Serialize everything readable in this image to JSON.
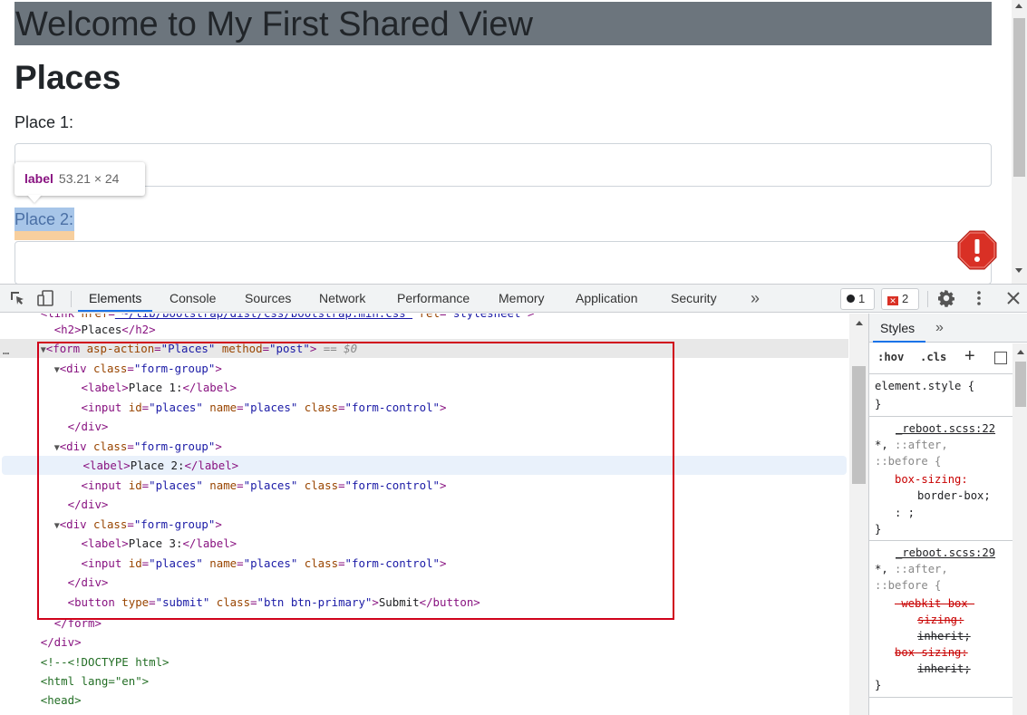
{
  "page": {
    "title": "Welcome to My First Shared View",
    "heading": "Places",
    "label_1": "Place 1:",
    "label_2": "Place 2:",
    "colors": {
      "title_bg": "#6c757d",
      "highlight": "#a7c5e8",
      "error_badge": "#d93025"
    }
  },
  "tooltip": {
    "tag": "label",
    "dims": "53.21 × 24"
  },
  "devtools": {
    "tabs": [
      "Elements",
      "Console",
      "Sources",
      "Network",
      "Performance",
      "Memory",
      "Application",
      "Security"
    ],
    "more_tabs": "»",
    "messages_count": "1",
    "errors_count": "2",
    "icons": [
      "inspect-icon",
      "device-toggle-icon",
      "gear-icon",
      "kebab-menu-icon",
      "close-icon"
    ]
  },
  "elements": {
    "dots": "…",
    "lines": [
      {
        "indent": 4,
        "html": "<link rel=\"stylesheet\" href=\"~/lib/bootstrap/dist/css/bootstrap.min.css\" />"
      },
      {
        "indent": 4,
        "open": "h2",
        "text": "Places"
      },
      {
        "indent": 3,
        "form": true
      },
      {
        "indent": 4,
        "div": "form-group"
      },
      {
        "indent": 6,
        "label": "Place 1:"
      },
      {
        "indent": 6,
        "input": true
      },
      {
        "indent": 5,
        "close": "div"
      },
      {
        "indent": 4,
        "div": "form-group"
      },
      {
        "indent": 6,
        "label": "Place 2:"
      },
      {
        "indent": 6,
        "input": true
      },
      {
        "indent": 5,
        "close": "div"
      },
      {
        "indent": 4,
        "div": "form-group"
      },
      {
        "indent": 6,
        "label": "Place 3:"
      },
      {
        "indent": 6,
        "input": true
      },
      {
        "indent": 5,
        "close": "div"
      },
      {
        "indent": 5,
        "button": "Submit"
      },
      {
        "indent": 4,
        "close": "form"
      },
      {
        "indent": 3,
        "close": "div"
      },
      {
        "indent": 3,
        "comment": "<!--<!DOCTYPE html>"
      },
      {
        "indent": 3,
        "html_lang": "en"
      },
      {
        "indent": 3,
        "open_only": "head"
      }
    ],
    "form_action": "Places",
    "form_method": "post",
    "dollar_zero": "== $0",
    "input_id": "places",
    "input_name": "places",
    "input_class": "form-control",
    "button_type": "submit",
    "button_class": "btn btn-primary"
  },
  "styles": {
    "tab": "Styles",
    "more": "»",
    "hov": ":hov",
    "cls": ".cls",
    "plus": "+",
    "element_style": "element.style {",
    "close_brace": "}",
    "rule1_source": "_reboot.scss:22",
    "rule1_selector_a": "*, ",
    "rule1_selector_b": "::after,",
    "rule1_selector_c": "::before {",
    "rule1_prop": "box-sizing:",
    "rule1_val": "border-box;",
    "rule1_cursor": ": ;",
    "rule2_source": "_reboot.scss:29",
    "rule2_selector_a": "*, ",
    "rule2_selector_b": "::after,",
    "rule2_selector_c": "::before {",
    "rule2_prop1": "-webkit-box-",
    "rule2_prop1b": "sizing:",
    "rule2_val1": "inherit;",
    "rule2_prop2": "box-sizing:",
    "rule2_val2": "inherit;"
  }
}
